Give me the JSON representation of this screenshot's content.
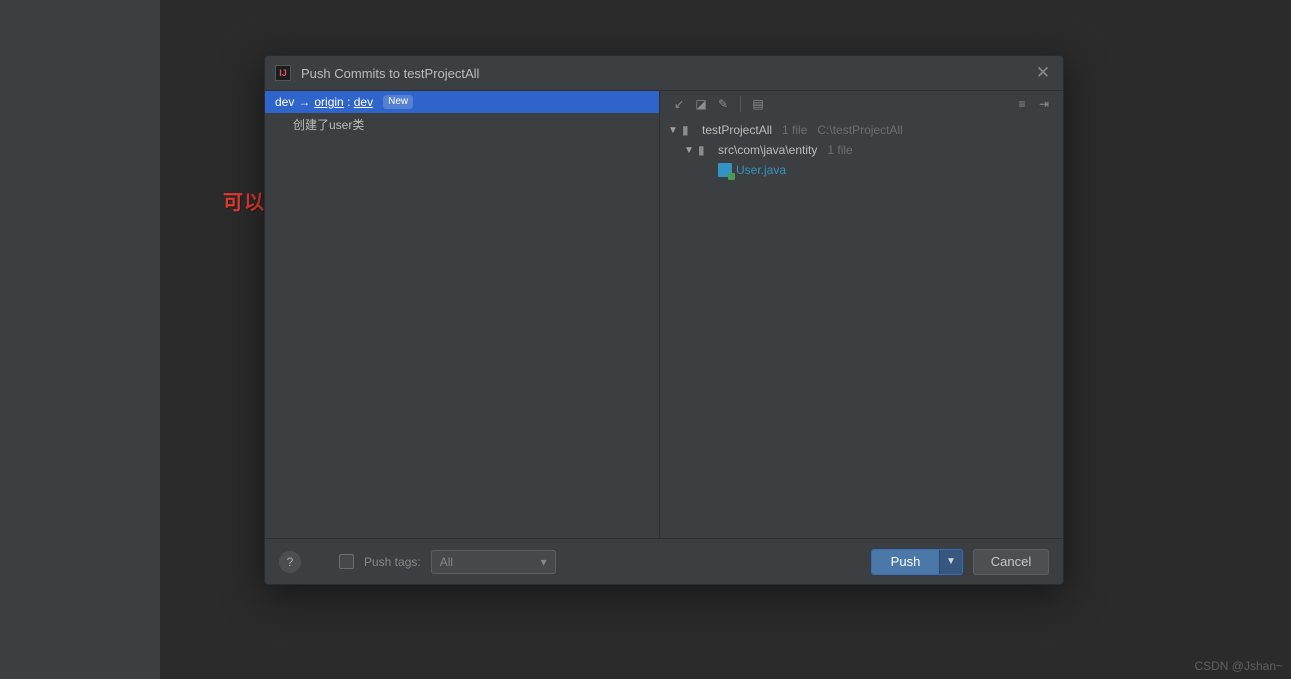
{
  "annotation_text": "可以看到这里分支是以dev进行代码推送",
  "dialog": {
    "title": "Push Commits to testProjectAll",
    "branch": {
      "local": "dev",
      "remote": "origin",
      "target": "dev",
      "new_badge": "New"
    },
    "commit_message": "创建了user类",
    "tree": {
      "root": {
        "name": "testProjectAll",
        "meta_count": "1 file",
        "meta_path": "C:\\testProjectAll"
      },
      "pkg": {
        "name": "src\\com\\java\\entity",
        "meta_count": "1 file"
      },
      "file": {
        "name": "User.java"
      }
    },
    "footer": {
      "push_tags_label": "Push tags:",
      "push_tags_value": "All",
      "push_button": "Push",
      "cancel_button": "Cancel"
    }
  },
  "watermark": "CSDN @Jshan~",
  "icons": {
    "help": "?",
    "close": "✕",
    "toolbar1": "↙",
    "toolbar2": "◪",
    "toolbar3": "✎",
    "toolbar4": "▤",
    "toolbar5": "≡",
    "toolbar6": "⇥",
    "folder": "▮"
  }
}
